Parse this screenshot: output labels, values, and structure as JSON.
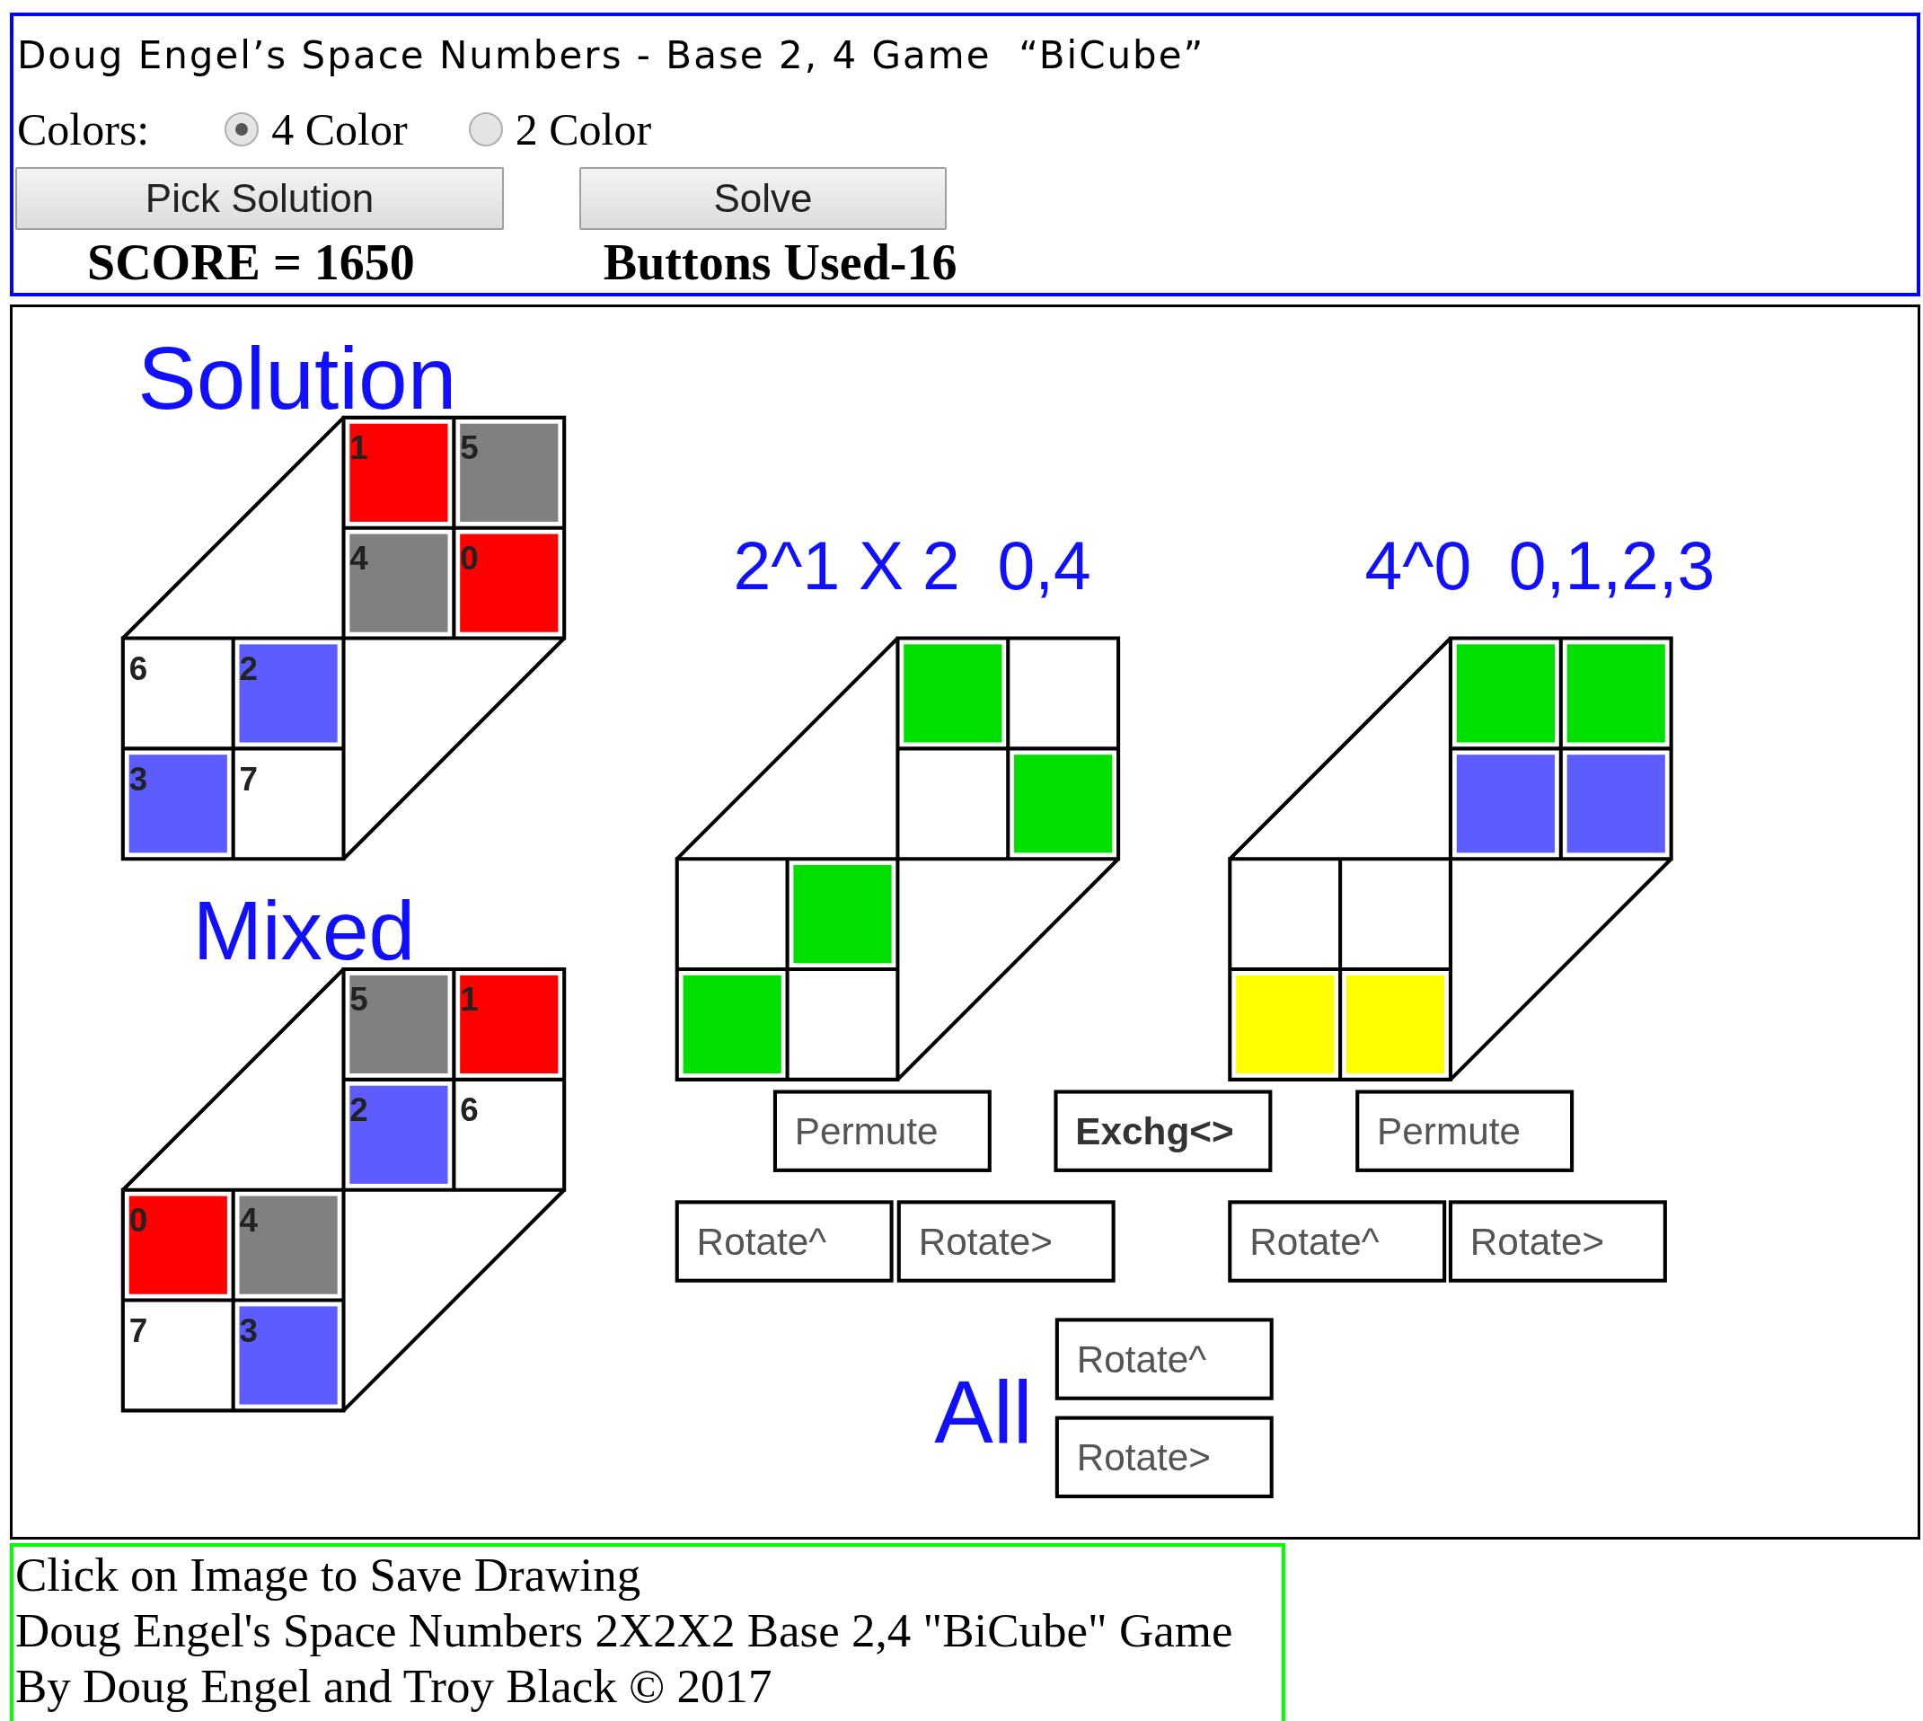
{
  "title": "Doug Engel’s Space Numbers - Base 2, 4 Game  “BiCube”",
  "colors": {
    "label": "Colors:",
    "options": [
      {
        "label": "4 Color",
        "selected": true
      },
      {
        "label": "2 Color",
        "selected": false
      }
    ]
  },
  "buttons": [
    "Pick Solution",
    "Solve"
  ],
  "score": "SCORE = 1650",
  "buttons_used": "Buttons Used-16",
  "canvas": {
    "cubes": [
      {
        "heading": "Solution",
        "cells": [
          {
            "label": "1",
            "color": "#ff0000"
          },
          {
            "label": "5",
            "color": "#808080"
          },
          {
            "label": "4",
            "color": "#808080"
          },
          {
            "label": "0",
            "color": "#ff0000"
          },
          {
            "label": "6"
          },
          {
            "label": "2",
            "color": "#5c5cff"
          },
          {
            "label": "3",
            "color": "#5c5cff"
          },
          {
            "label": "7"
          }
        ]
      },
      {
        "heading": "Mixed",
        "cells": [
          {
            "label": "5",
            "color": "#808080"
          },
          {
            "label": "1",
            "color": "#ff0000"
          },
          {
            "label": "2",
            "color": "#5c5cff"
          },
          {
            "label": "6"
          },
          {
            "label": "0",
            "color": "#ff0000"
          },
          {
            "label": "4",
            "color": "#808080"
          },
          {
            "label": "7"
          },
          {
            "label": "3",
            "color": "#5c5cff"
          }
        ]
      },
      {
        "heading": "2^1 X 2  0,4",
        "cells": [
          {
            "color": "#00e000"
          },
          {},
          {},
          {
            "color": "#00e000"
          },
          {},
          {
            "color": "#00e000"
          },
          {
            "color": "#00e000"
          },
          {}
        ]
      },
      {
        "heading": "4^0  0,1,2,3",
        "cells": [
          {
            "color": "#00e000"
          },
          {
            "color": "#00e000"
          },
          {
            "color": "#5c5cff"
          },
          {
            "color": "#5c5cff"
          },
          {},
          {},
          {
            "color": "#ffff00"
          },
          {
            "color": "#ffff00"
          }
        ]
      }
    ],
    "controls": [
      {
        "label": "Permute",
        "bold": false
      },
      {
        "label": "Exchg<>",
        "bold": true
      },
      {
        "label": "Permute",
        "bold": false
      },
      {
        "label": "Rotate^",
        "bold": false
      },
      {
        "label": "Rotate>",
        "bold": false
      },
      {
        "label": "Rotate^",
        "bold": false
      },
      {
        "label": "Rotate>",
        "bold": false
      },
      {
        "label": "Rotate^",
        "bold": false
      },
      {
        "label": "Rotate>",
        "bold": false
      }
    ],
    "all_label": "All"
  },
  "footer": [
    "Click on Image to Save Drawing",
    "Doug Engel's Space Numbers 2X2X2 Base 2,4 \"BiCube\" Game",
    "By Doug Engel and Troy Black © 2017"
  ]
}
